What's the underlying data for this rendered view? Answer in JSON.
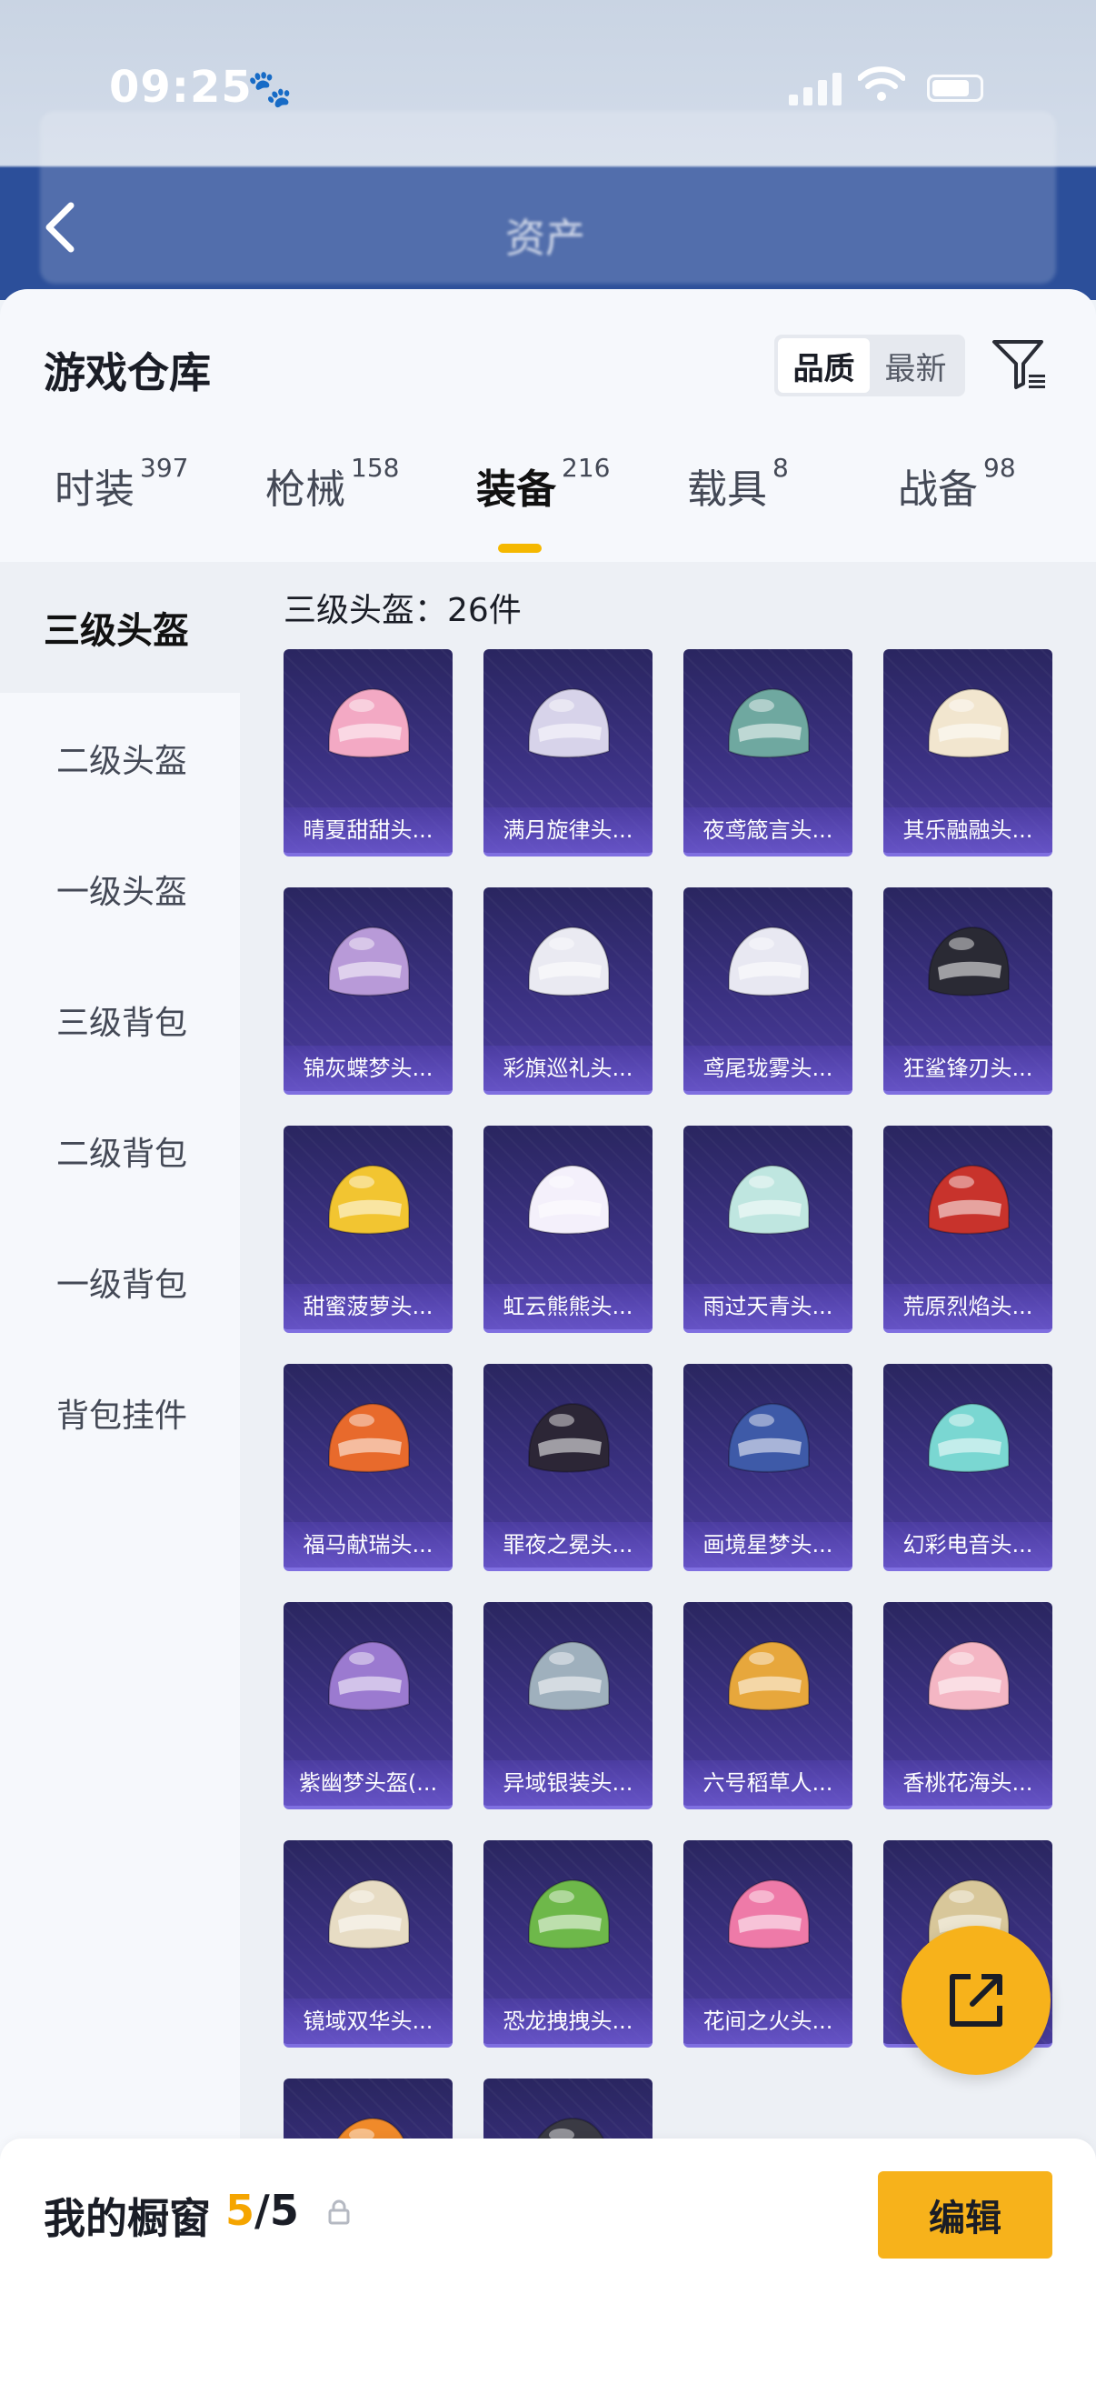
{
  "status_bar": {
    "time": "09:25"
  },
  "nav": {
    "title": "资产"
  },
  "sheet": {
    "title": "游戏仓库",
    "sort_options": [
      "品质",
      "最新"
    ],
    "selected_sort": "品质"
  },
  "tabs": [
    {
      "label": "时装",
      "count": "397"
    },
    {
      "label": "枪械",
      "count": "158"
    },
    {
      "label": "装备",
      "count": "216"
    },
    {
      "label": "载具",
      "count": "8"
    },
    {
      "label": "战备",
      "count": "98"
    }
  ],
  "active_tab": "装备",
  "sidebar": {
    "items": [
      "三级头盔",
      "二级头盔",
      "一级头盔",
      "三级背包",
      "二级背包",
      "一级背包",
      "背包挂件"
    ],
    "active": "三级头盔"
  },
  "grid": {
    "count_label": "三级头盔：26件",
    "items": [
      {
        "name": "晴夏甜甜头...",
        "color": "#f3a9c4"
      },
      {
        "name": "满月旋律头...",
        "color": "#d7d3ea"
      },
      {
        "name": "夜鸢箴言头...",
        "color": "#6fa8a0"
      },
      {
        "name": "其乐融融头...",
        "color": "#f2e6cf"
      },
      {
        "name": "锦灰蝶梦头...",
        "color": "#b89ad8"
      },
      {
        "name": "彩旗巡礼头...",
        "color": "#eaeaf2"
      },
      {
        "name": "鸢尾珑雾头...",
        "color": "#e8e8f2"
      },
      {
        "name": "狂鲨锋刃头...",
        "color": "#2a2a34"
      },
      {
        "name": "甜蜜菠萝头...",
        "color": "#f2c531"
      },
      {
        "name": "虹云熊熊头...",
        "color": "#f4f0fb"
      },
      {
        "name": "雨过天青头...",
        "color": "#bfe6e0"
      },
      {
        "name": "荒原烈焰头...",
        "color": "#c8332c"
      },
      {
        "name": "福马献瑞头...",
        "color": "#e86a2c"
      },
      {
        "name": "罪夜之冕头...",
        "color": "#2c2636"
      },
      {
        "name": "画境星梦头...",
        "color": "#3e5aa8"
      },
      {
        "name": "幻彩电音头...",
        "color": "#7ad7d2"
      },
      {
        "name": "紫幽梦头盔(...",
        "color": "#9b7ad0"
      },
      {
        "name": "异域银装头...",
        "color": "#9fb0bd"
      },
      {
        "name": "六号稻草人...",
        "color": "#e7a73c"
      },
      {
        "name": "香桃花海头...",
        "color": "#f4b6c4"
      },
      {
        "name": "镜域双华头...",
        "color": "#e7dcc4"
      },
      {
        "name": "恐龙拽拽头...",
        "color": "#6eb84a"
      },
      {
        "name": "花间之火头...",
        "color": "#ee7aa8"
      },
      {
        "name": "",
        "color": "#d8c79a"
      },
      {
        "name": "",
        "color": "#f08a2a"
      },
      {
        "name": "",
        "color": "#3a3a44"
      }
    ]
  },
  "showcase": {
    "title": "我的橱窗",
    "current": "5",
    "separator": "/",
    "total": "5",
    "edit_label": "编辑"
  }
}
